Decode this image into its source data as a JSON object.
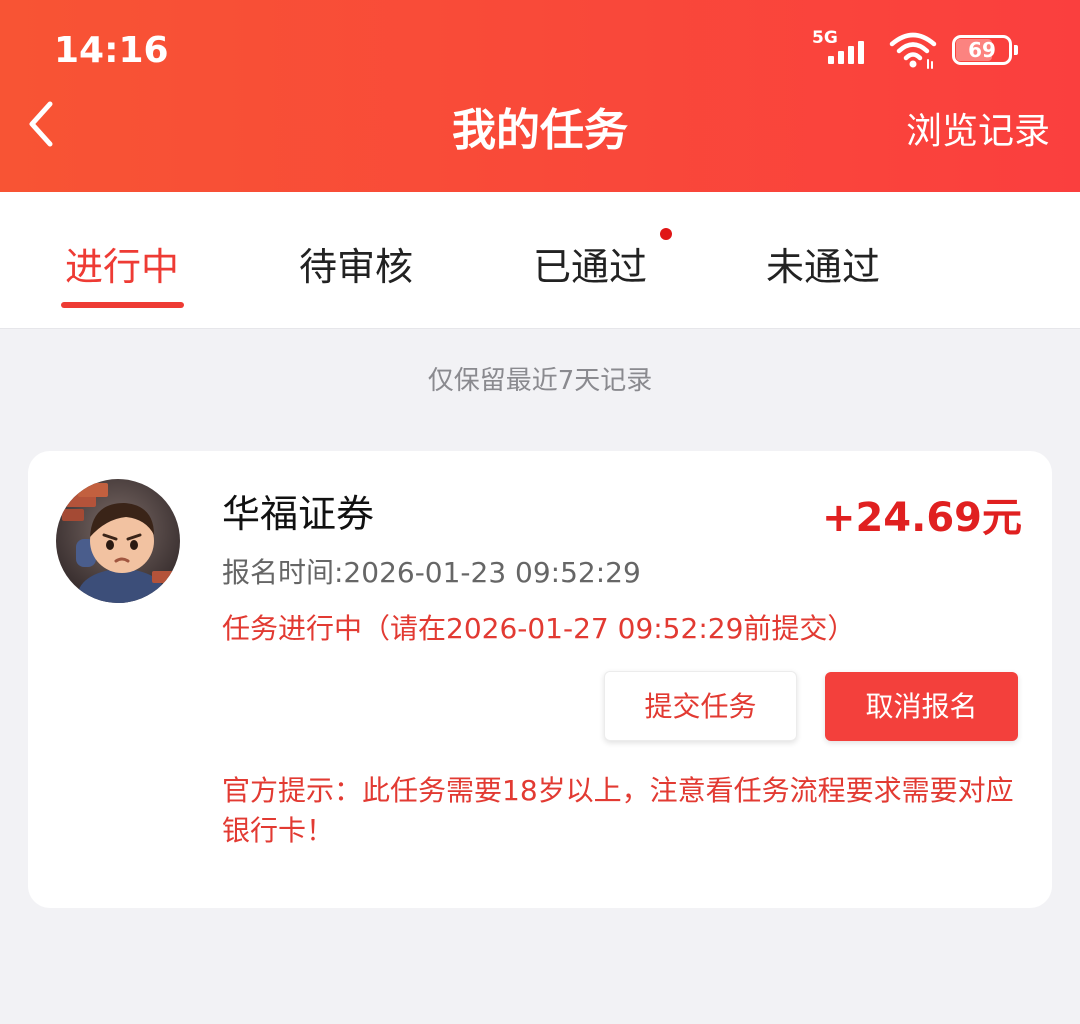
{
  "status_bar": {
    "time": "14:16",
    "network": "5G",
    "battery": "69",
    "battery_level": 0.69,
    "wifi_icon": "wifi-icon",
    "signal_icon": "signal-icon"
  },
  "header": {
    "back_icon": "chevron-left-icon",
    "title": "我的任务",
    "history_link": "浏览记录"
  },
  "tabs": [
    {
      "label": "进行中",
      "active": true
    },
    {
      "label": "待审核",
      "active": false
    },
    {
      "label": "已通过",
      "active": false,
      "badge_dot": true
    },
    {
      "label": "未通过",
      "active": false
    }
  ],
  "notice": "仅保留最近7天记录",
  "task": {
    "avatar": "avatar-image",
    "name": "华福证券",
    "reward": "+24.69元",
    "signup_time": "报名时间:2026-01-23 09:52:29",
    "status": "任务进行中（请在2026-01-27 09:52:29前提交）",
    "submit_label": "提交任务",
    "cancel_label": "取消报名",
    "tip": "官方提示：此任务需要18岁以上，注意看任务流程要求需要对应银行卡！"
  },
  "colors": {
    "header_gradient_start": "#f85434",
    "header_gradient_end": "#fa3f3e",
    "accent_red": "#ee3b34",
    "reward_red": "#e02020",
    "page_bg": "#f2f2f5"
  }
}
